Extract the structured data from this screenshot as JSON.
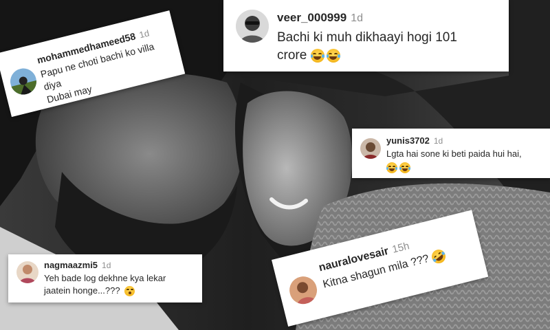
{
  "photo": {
    "description_colors": {
      "background": "#2a2a2a"
    }
  },
  "comments": [
    {
      "id": "veer",
      "username": "veer_000999",
      "time": "1d",
      "text": "Bachi ki muh dikhaayi hogi 101 crore",
      "emoji": "face-with-tears-of-joy-icon x2"
    },
    {
      "id": "mohammed",
      "username": "mohammedhameed58",
      "time": "1d",
      "text_line1": "Papu ne choti bachi ko villa diya",
      "text_line2": "Dubai may"
    },
    {
      "id": "yunis",
      "username": "yunis3702",
      "time": "1d",
      "text": "Lgta hai sone ki beti paida hui hai,",
      "emoji": "face-with-tears-of-joy-icon x2"
    },
    {
      "id": "nagma",
      "username": "nagmaazmi5",
      "time": "1d",
      "text_line1": "Yeh bade log dekhne kya lekar",
      "text_line2": "jaatein honge...???",
      "emoji": "face-with-open-mouth-icon"
    },
    {
      "id": "naura",
      "username": "nauralovesair",
      "time": "15h",
      "text": "Kitna shagun mila ???",
      "emoji": "rolling-on-the-floor-laughing-icon"
    }
  ]
}
